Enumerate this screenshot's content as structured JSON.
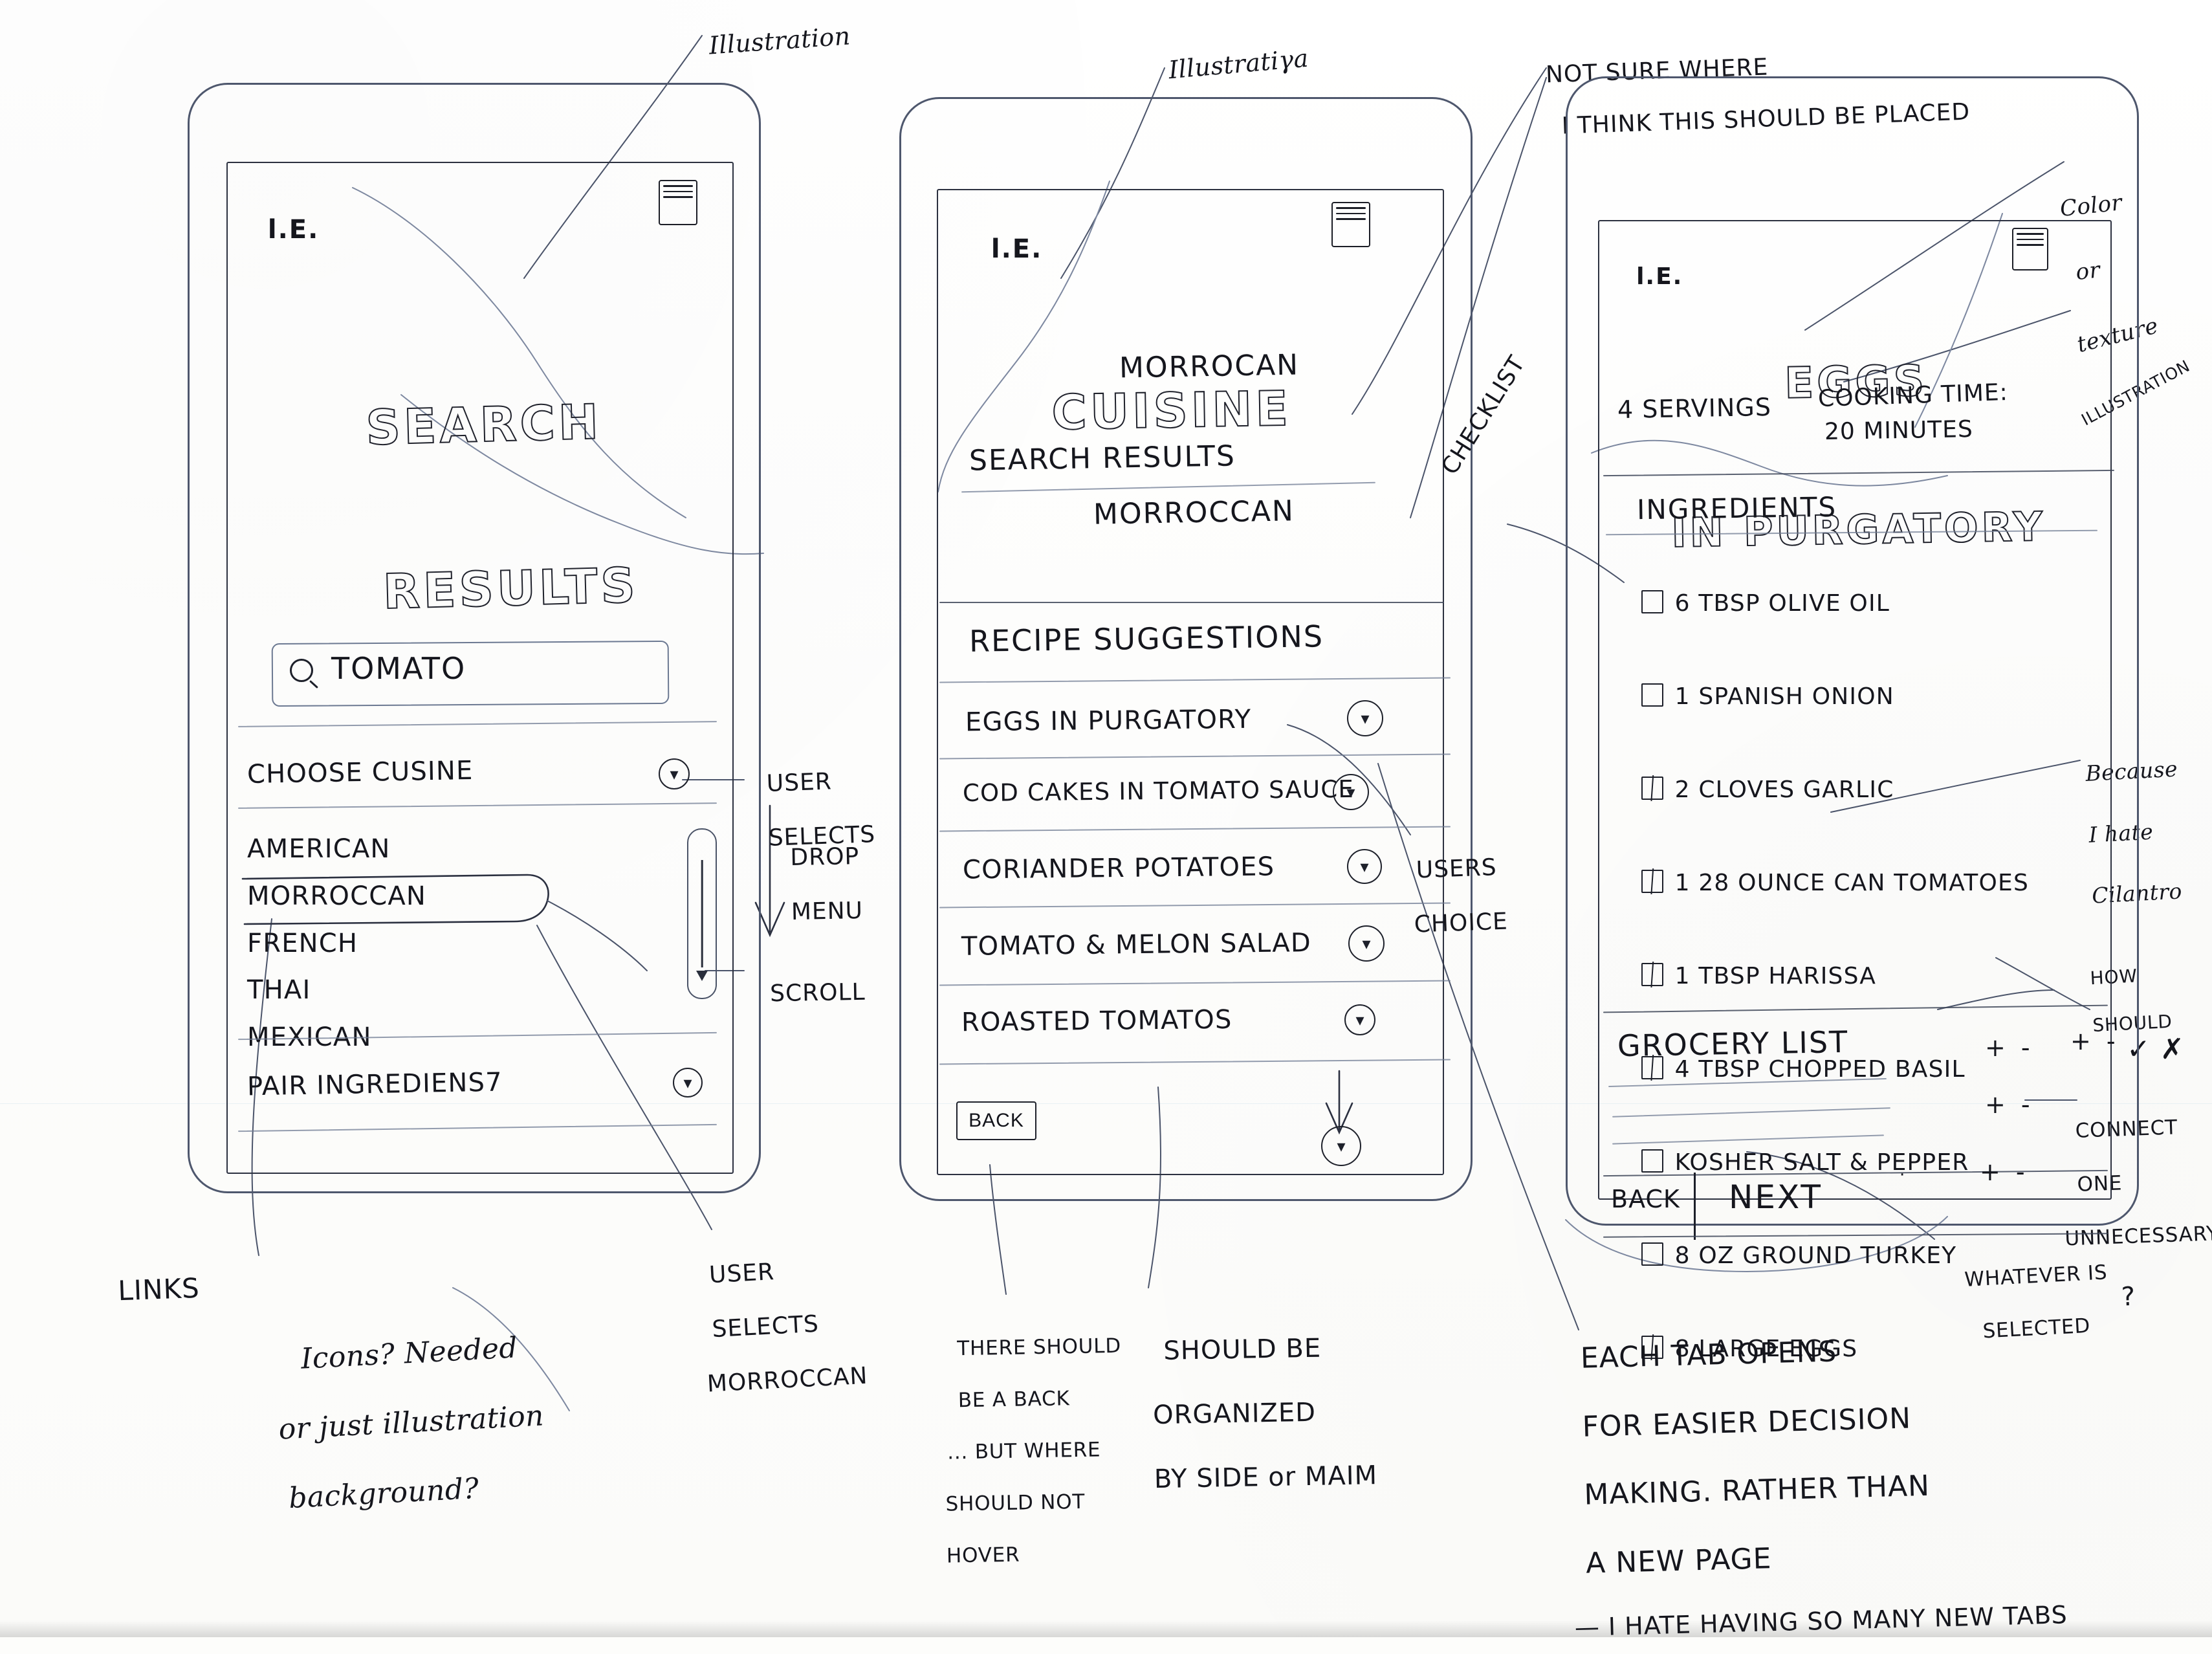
{
  "document": {
    "type": "hand-drawn-wireframe-sketch",
    "subject": "Recipe app mobile wireframes with designer annotations"
  },
  "top_annotations": [
    {
      "id": "illustration-1",
      "text": "Illustration"
    },
    {
      "id": "illustration-2",
      "text": "Illustratiγa"
    },
    {
      "id": "placement-note",
      "line1": "NOT SURE WHERE",
      "line2": "I THINK THIS SHOULD BE PLACED"
    }
  ],
  "screen1": {
    "name": "search-results-screen",
    "logo": "l.E.",
    "menu_icon": "hamburger-menu-icon",
    "title_line1": "SEARCH",
    "title_line2": "RESULTS",
    "search": {
      "icon": "search-icon",
      "value": "TOMATO"
    },
    "choose_cuisine": {
      "label": "CHOOSE CUSINE",
      "dropdown_icon": "chevron-down-icon"
    },
    "cuisines": [
      "AMERICAN",
      "MORROCCAN",
      "FRENCH",
      "THAI",
      "MEXICAN"
    ],
    "selected_cuisine": "MORROCCAN",
    "pair_ingredients": {
      "label": "PAIR INGREDIENS7",
      "dropdown_icon": "chevron-down-icon"
    },
    "scrollbar": "vertical-scroll-handle"
  },
  "screen1_annotations": [
    {
      "id": "user-selects",
      "line1": "USER",
      "line2": "SELECTS"
    },
    {
      "id": "drop-menu",
      "line1": "DROP",
      "line2": "MENU"
    },
    {
      "id": "scroll",
      "text": "SCROLL"
    },
    {
      "id": "links",
      "text": "LINKS"
    },
    {
      "id": "user-selects-morroccan",
      "line1": "USER",
      "line2": "SELECTS",
      "line3": "MORROCCAN"
    },
    {
      "id": "icons-question",
      "line1": "Icons? Needed",
      "line2": "or just illustration",
      "line3": "background?"
    }
  ],
  "screen2": {
    "name": "cuisine-results-screen",
    "logo": "l.E.",
    "menu_icon": "hamburger-menu-icon",
    "title": "CUISINE",
    "subtitle": "MORROCAN",
    "section_label": "SEARCH RESULTS",
    "section_value": "MORROCCAN",
    "suggestions_header": "RECIPE SUGGESTIONS",
    "suggestions": [
      {
        "label": "EGGS IN PURGATORY",
        "icon": "dropdown-caret-icon"
      },
      {
        "label": "COD CAKES IN TOMATO SAUCE",
        "icon": "dropdown-caret-icon"
      },
      {
        "label": "CORIANDER POTATOES",
        "icon": "dropdown-caret-icon"
      },
      {
        "label": "TOMATO & MELON SALAD",
        "icon": "dropdown-caret-icon"
      },
      {
        "label": "ROASTED TOMATOS",
        "icon": "dropdown-caret-icon"
      }
    ],
    "back_button": "BACK",
    "scroll_down_icon": "scroll-down-caret-icon"
  },
  "screen2_annotations": [
    {
      "id": "checklist",
      "text": "CHECKLIST"
    },
    {
      "id": "users-choice",
      "line1": "USERS",
      "line2": "CHOICE"
    },
    {
      "id": "back-note",
      "line1": "THERE SHOULD",
      "line2": "BE A BACK",
      "line3": "... BUT WHERE",
      "line4": "SHOULD NOT",
      "line5": "HOVER"
    },
    {
      "id": "organize-note",
      "line1": "SHOULD BE",
      "line2": "ORGANIZED",
      "line3": "BY SIDE or MAIM"
    }
  ],
  "screen3": {
    "name": "recipe-detail-screen",
    "logo": "l.E.",
    "menu_icon": "hamburger-menu-icon",
    "title_line1": "EGGS",
    "title_line2": "IN PURGATORY",
    "servings": "4 SERVINGS",
    "cooking_time_label": "COOKING TIME:",
    "cooking_time_value": "20 MINUTES",
    "ingredients_header": "INGREDIENTS",
    "ingredients": [
      {
        "qty_text": "6 TBSP OLIVE OIL",
        "checked": false
      },
      {
        "qty_text": "1 SPANISH ONION",
        "checked": false
      },
      {
        "qty_text": "2 CLOVES GARLIC",
        "checked": false
      },
      {
        "qty_text": "1 28 OUNCE CAN TOMATOES",
        "checked": true
      },
      {
        "qty_text": "1 TBSP HARISSA",
        "checked": true
      },
      {
        "qty_text": "4 TBSP CHOPPED BASIL",
        "checked": true
      },
      {
        "qty_text": "KOSHER SALT & PEPPER",
        "checked": false
      },
      {
        "qty_text": "8 OZ GROUND TURKEY",
        "checked": false
      },
      {
        "qty_text": "8 LARGE EGGS",
        "checked": true
      }
    ],
    "grocery_list_header": "GROCERY LIST",
    "back_button": "BACK",
    "next_button": "NEXT",
    "steppers": [
      "+ -",
      "+ -",
      "+ -",
      "+ -",
      "+ -"
    ]
  },
  "screen3_annotations": [
    {
      "id": "color-texture",
      "line1": "Color",
      "line2": "or",
      "line3": "texture",
      "line4": "ILLUSTRATION"
    },
    {
      "id": "cilantro-note",
      "line1": "Because",
      "line2": "I hate",
      "line3": "Cilantro"
    },
    {
      "id": "how-should-note",
      "line1": "HOW",
      "line2": "SHOULD",
      "mark": "✓ ✗"
    },
    {
      "id": "connect-note",
      "line1": "CONNECT",
      "line2": "ONE",
      "line3": "UNNECESSARY",
      "line4": "?"
    },
    {
      "id": "whatever-selected",
      "line1": "WHATEVER IS",
      "line2": "SELECTED"
    },
    {
      "id": "tab-note",
      "line1": "EACH TAB OPENS",
      "line2": "FOR EASIER DECISION",
      "line3": "MAKING. RATHER THAN",
      "line4": "A NEW PAGE",
      "line5": "— I HATE HAVING SO MANY NEW TABS"
    }
  ],
  "colors": {
    "ink": "#14151c",
    "pencil": "#5b6478",
    "paper": "#fdfdfb"
  }
}
